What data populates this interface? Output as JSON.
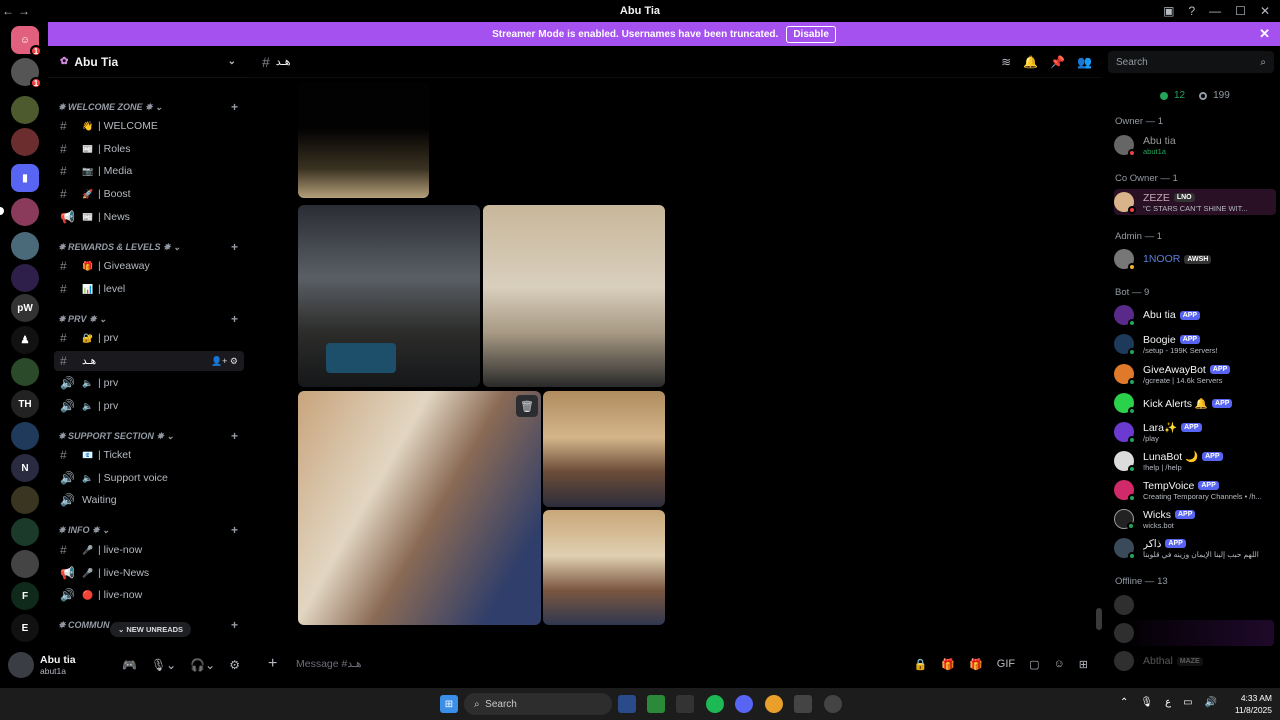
{
  "window": {
    "title": "Abu Tia",
    "back": "←",
    "forward": "→"
  },
  "banner": {
    "text": "Streamer Mode is enabled. Usernames have been truncated.",
    "button": "Disable"
  },
  "server": {
    "name": "Abu Tia"
  },
  "channel_header": {
    "name": "هـد"
  },
  "search": {
    "placeholder": "Search"
  },
  "categories": [
    {
      "label": "✵ WELCOME ZONE ✵",
      "channels": [
        {
          "emoji": "👋",
          "label": "| WELCOME"
        },
        {
          "emoji": "📰",
          "label": "| Roles"
        },
        {
          "emoji": "📷",
          "label": "| Media"
        },
        {
          "emoji": "🚀",
          "label": "| Boost"
        },
        {
          "emoji": "📰",
          "label": "| News"
        }
      ]
    },
    {
      "label": "✵ REWARDS & LEVELS ✵",
      "channels": [
        {
          "emoji": "🎁",
          "label": "| Giveaway"
        },
        {
          "emoji": "📊",
          "label": "| level"
        }
      ]
    },
    {
      "label": "✵ PRV ✵",
      "channels": [
        {
          "emoji": "🔐",
          "label": "| prv"
        },
        {
          "emoji": "",
          "label": "هـد"
        },
        {
          "emoji": "🔈",
          "label": "| prv"
        },
        {
          "emoji": "🔈",
          "label": "| prv"
        }
      ]
    },
    {
      "label": "✵ SUPPORT SECTION ✵",
      "channels": [
        {
          "emoji": "📧",
          "label": "| Ticket"
        },
        {
          "emoji": "🔈",
          "label": "| Support voice"
        },
        {
          "emoji": "",
          "label": "Waiting"
        }
      ]
    },
    {
      "label": "✵ INFO ✵",
      "channels": [
        {
          "emoji": "🎤",
          "label": "| live-now"
        },
        {
          "emoji": "🎤",
          "label": "| live-News"
        },
        {
          "emoji": "🔴",
          "label": "| live-now"
        }
      ]
    },
    {
      "label": "✵ COMMUN",
      "channels": []
    }
  ],
  "new_unreads": "NEW UNREADS",
  "user": {
    "name": "Abu tia",
    "status": "abut1a"
  },
  "composer": {
    "placeholder": "Message #هـد"
  },
  "members": {
    "online_count": "12",
    "total_count": "199",
    "sections": [
      {
        "label": "Owner — 1",
        "members": [
          {
            "name": "Abu tia",
            "sub": "abut1a",
            "badge": ""
          }
        ]
      },
      {
        "label": "Co Owner — 1",
        "members": [
          {
            "name": "ZEZE",
            "sub": "\"C STARS CAN'T SHINE WIT...",
            "badge": "LNO"
          }
        ]
      },
      {
        "label": "Admin — 1",
        "members": [
          {
            "name": "1NOOR",
            "sub": "",
            "badge": "AWSH"
          }
        ]
      },
      {
        "label": "Bot — 9",
        "members": [
          {
            "name": "Abu tia",
            "sub": "",
            "badge": "APP"
          },
          {
            "name": "Boogie",
            "sub": "/setup - 199K Servers!",
            "badge": "APP"
          },
          {
            "name": "GiveAwayBot",
            "sub": "/gcreate | 14.6k Servers",
            "badge": "APP"
          },
          {
            "name": "Kick Alerts 🔔",
            "sub": "",
            "badge": "APP"
          },
          {
            "name": "Lara✨",
            "sub": "/play",
            "badge": "APP"
          },
          {
            "name": "LunaBot 🌙",
            "sub": "!help | /help",
            "badge": "APP"
          },
          {
            "name": "TempVoice",
            "sub": "Creating Temporary Channels • /h...",
            "badge": "APP"
          },
          {
            "name": "Wicks",
            "sub": "wicks.bot",
            "badge": "APP"
          },
          {
            "name": "ذاكر",
            "sub": "اللهم حبب إلينا الإيمان وزينه في قلوبنا",
            "badge": "APP"
          }
        ]
      },
      {
        "label": "Offline — 13",
        "members": [
          {
            "name": "",
            "sub": "",
            "badge": ""
          },
          {
            "name": "",
            "sub": "",
            "badge": ""
          },
          {
            "name": "Abthal",
            "sub": "",
            "badge": "MAZE"
          }
        ]
      }
    ]
  },
  "taskbar": {
    "search": "Search",
    "time": "4:33 AM",
    "date": "11/8/2025"
  },
  "colors": {
    "banner": "#a451f0",
    "online": "#23a55a",
    "app_badge": "#5865f2"
  }
}
